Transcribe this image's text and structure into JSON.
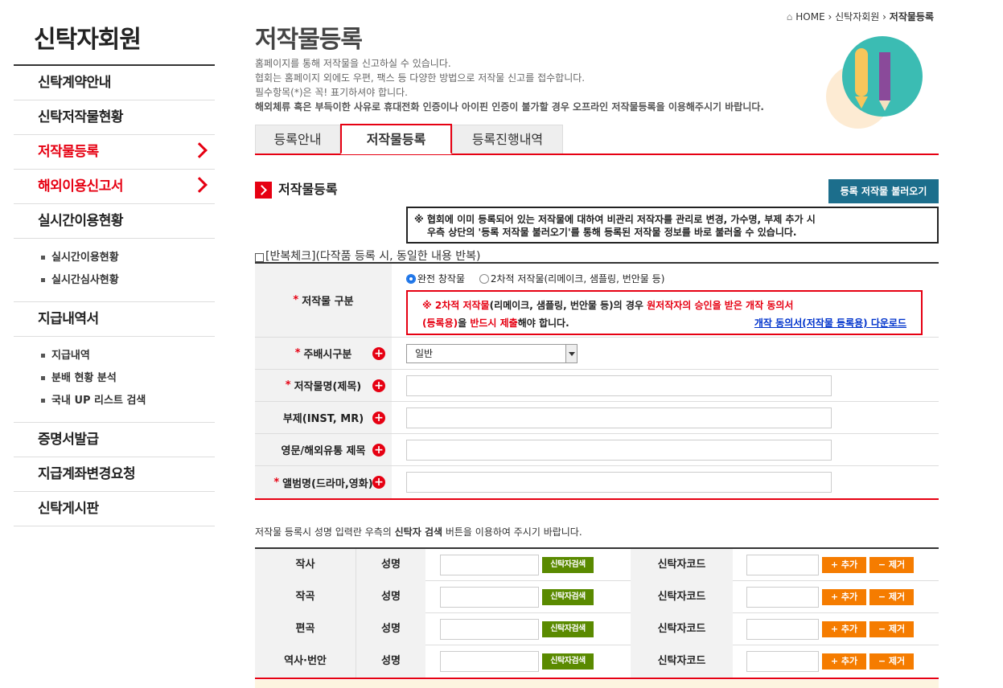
{
  "sidebar": {
    "title": "신탁자회원",
    "items": [
      {
        "label": "신탁계약안내"
      },
      {
        "label": "신탁저작물현황"
      },
      {
        "label": "저작물등록"
      },
      {
        "label": "해외이용신고서"
      },
      {
        "label": "실시간이용현황"
      }
    ],
    "sub1": [
      "실시간이용현황",
      "실시간심사현황"
    ],
    "item_pay": "지급내역서",
    "sub2": [
      "지급내역",
      "분배 현황 분석",
      "국내 UP 리스트 검색"
    ],
    "items2": [
      "증명서발급",
      "지급계좌변경요청",
      "신탁게시판"
    ]
  },
  "breadcrumb": {
    "home": "HOME",
    "level1": "신탁자회원",
    "current": "저작물등록"
  },
  "page": {
    "title": "저작물등록",
    "intro": [
      "홈페이지를 통해 저작물을 신고하실 수 있습니다.",
      "협회는 홈페이지 외에도 우편, 팩스 등 다양한 방법으로 저작물 신고를 접수합니다.",
      "필수항목(*)은 꼭! 표기하셔야 합니다."
    ],
    "intro_bold": "해외체류 혹은 부득이한 사유로 휴대전화 인증이나 아이핀 인증이 불가할 경우 오프라인 저작물등록을 이용해주시기 바랍니다."
  },
  "tabs": [
    "등록안내",
    "저작물등록",
    "등록진행내역"
  ],
  "section": {
    "title": "저작물등록",
    "load_button": "등록 저작물 불러오기",
    "notice_line1": "※ 협회에 이미 등록되어 있는 저작물에 대하여 비관리 저작자를 관리로 변경, 가수명, 부제 추가 시",
    "notice_line2": "우측 상단의 '등록 저작물 불러오기'를 통해 등록된 저작물 정보를 바로 불러올 수 있습니다.",
    "repeat_check": "[반복체크](다작품 등록 시, 동일한 내용 반복)"
  },
  "form": {
    "work_type_label": "저작물 구분",
    "radio1": "완전 창작물",
    "radio2": "2차적 저작물(리메이크, 샘플링, 번안물 등)",
    "warn_prefix": "※ ",
    "warn_red1": "2차적 저작물",
    "warn_mid": "(리메이크, 샘플링, 번안물 등)의 경우 ",
    "warn_red2": "원저작자의 승인을 받은 개작 동의서",
    "warn_red3": "(등록용)",
    "warn_mid2": "을 ",
    "warn_red4": "반드시 제출",
    "warn_end": "해야 합니다.",
    "warn_link": "개작 동의서(저작물 등록용) 다운로드",
    "main_sub_label": "주배시구분",
    "main_sub_value": "일반",
    "title_label": "저작물명(제목)",
    "subtitle_label": "부제(INST, MR)",
    "eng_title_label": "영문/해외유통 제목",
    "album_label": "앨범명(드라마,영화)",
    "star": "*",
    "plus": "+"
  },
  "creators": {
    "note_pre": "저작물 등록시 성명 입력란 우측의 ",
    "note_bold": "신탁자 검색",
    "note_post": " 버튼을 이용하여 주시기 바랍니다.",
    "name_label": "성명",
    "code_label": "신탁자코드",
    "search_btn": "신탁자검색",
    "add_btn": "+ 추가",
    "remove_btn": "− 제거",
    "roles": [
      "작사",
      "작곡",
      "편곡",
      "역사·번안"
    ]
  },
  "colors": {
    "accent": "#e60012",
    "button_blue": "#1c6e8c",
    "search_green": "#5a8a00",
    "orange": "#f57c00"
  }
}
